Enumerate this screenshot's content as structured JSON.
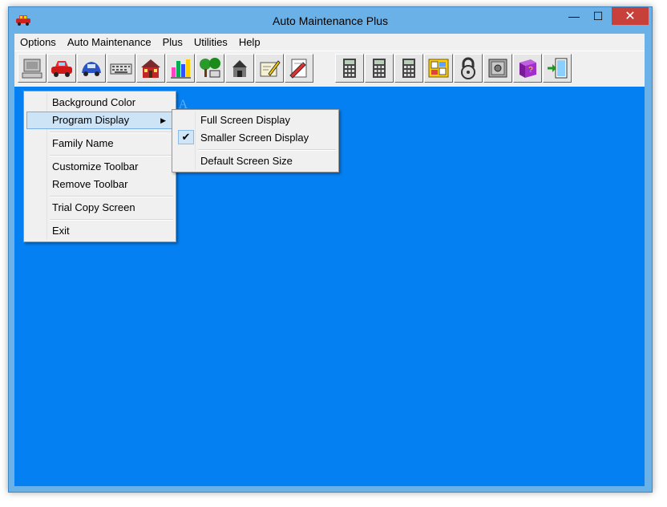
{
  "window": {
    "title": "Auto Maintenance Plus",
    "minimize_glyph": "—",
    "maximize_glyph": "☐",
    "close_glyph": "✕",
    "accent_color": "#0580f2"
  },
  "menubar": {
    "items": [
      "Options",
      "Auto Maintenance",
      "Plus",
      "Utilities",
      "Help"
    ]
  },
  "toolbar": {
    "icons": [
      "computer-icon",
      "red-car-icon",
      "blue-beetle-icon",
      "keyboard-icon",
      "house-icon",
      "bar-chart-icon",
      "tree-sign-icon",
      "mailbox-icon",
      "sign-pad-icon",
      "pencil-document-icon",
      "calculator-1-icon",
      "calculator-2-icon",
      "calculator-3-icon",
      "picture-board-icon",
      "padlock-icon",
      "safe-icon",
      "help-book-icon",
      "exit-door-icon"
    ]
  },
  "options_menu": {
    "items": [
      "Background Color",
      "Program Display",
      "Family Name",
      "Customize Toolbar",
      "Remove Toolbar",
      "Trial Copy Screen",
      "Exit"
    ],
    "submenu_arrow": "▶"
  },
  "program_display_submenu": {
    "items": [
      "Full Screen Display",
      "Smaller Screen Display",
      "Default Screen Size"
    ],
    "checked_glyph": "✔"
  },
  "watermark": "SOFTPEDIA"
}
